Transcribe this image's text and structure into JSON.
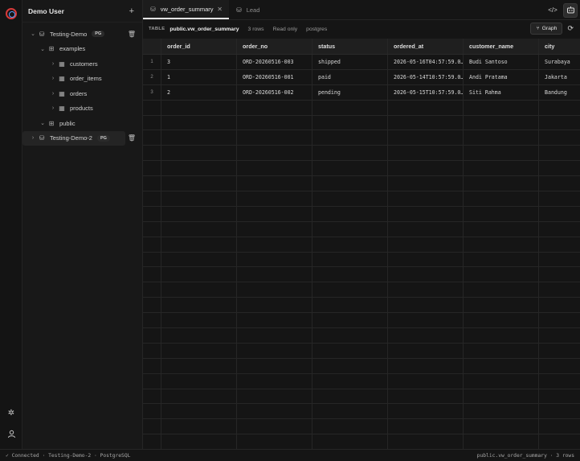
{
  "rail": {
    "settings_icon": "gear-icon",
    "profile_icon": "user-icon"
  },
  "sidebar": {
    "user": "Demo User",
    "add_label": "+",
    "connections": [
      {
        "name": "Testing-Demo",
        "badge": "PG",
        "expanded": true,
        "schemas": [
          {
            "name": "examples",
            "tables": [
              "customers",
              "order_items",
              "orders",
              "products"
            ]
          },
          {
            "name": "public",
            "tables": []
          }
        ]
      },
      {
        "name": "Testing-Demo-2",
        "badge": "PG",
        "expanded": false
      }
    ]
  },
  "tabs": {
    "items": [
      {
        "label": "vw_order_summary",
        "active": true
      },
      {
        "label": "Lead",
        "active": false
      }
    ]
  },
  "infobar": {
    "kind": "TABLE",
    "name": "public.vw_order_summary",
    "rows": "3 rows",
    "mode": "Read only",
    "owner": "postgres",
    "graph_label": "Graph"
  },
  "grid": {
    "columns": [
      "order_id",
      "order_no",
      "status",
      "ordered_at",
      "customer_name",
      "city"
    ],
    "rows": [
      {
        "n": "1",
        "cells": [
          "3",
          "ORD-20260516-003",
          "shipped",
          "2026-05-16T04:57:59.0…",
          "Budi Santoso",
          "Surabaya"
        ]
      },
      {
        "n": "2",
        "cells": [
          "1",
          "ORD-20260516-001",
          "paid",
          "2026-05-14T10:57:59.0…",
          "Andi Pratama",
          "Jakarta"
        ]
      },
      {
        "n": "3",
        "cells": [
          "2",
          "ORD-20260516-002",
          "pending",
          "2026-05-15T10:57:59.0…",
          "Siti Rahma",
          "Bandung"
        ]
      }
    ]
  },
  "statusbar": {
    "left": "✓ Connected · Testing-Demo-2 · PostgreSQL",
    "right": "public.vw_order_summary · 3 rows"
  }
}
